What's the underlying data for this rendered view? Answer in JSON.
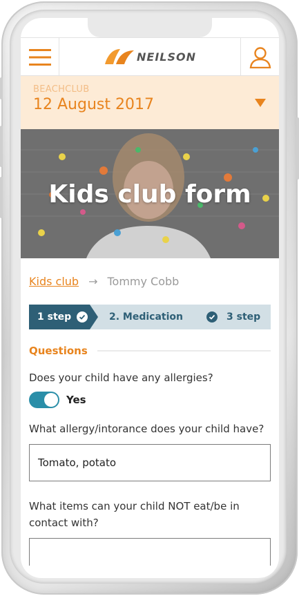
{
  "header": {
    "logo_text": "NEILSON"
  },
  "datebar": {
    "label": "BEACHCLUB",
    "value": "12 August 2017"
  },
  "hero": {
    "title": "Kids club form"
  },
  "breadcrumb": {
    "parent": "Kids club",
    "current": "Tommy Cobb"
  },
  "steps": [
    {
      "label": "1 step"
    },
    {
      "label": "2. Medication"
    },
    {
      "label": "3 step"
    }
  ],
  "questions": {
    "section_title": "Questions",
    "q1": "Does your child have any allergies?",
    "q1_toggle_label": "Yes",
    "q2": "What allergy/intorance does your child have?",
    "q2_value": "Tomato, potato",
    "q3": "What items can your child NOT eat/be in contact with?"
  },
  "colors": {
    "accent": "#e8841e",
    "date_bg": "#fdebd6",
    "step_active": "#2e5f76",
    "step_inactive": "#d2dfe5",
    "toggle_on": "#2a8ea8"
  }
}
